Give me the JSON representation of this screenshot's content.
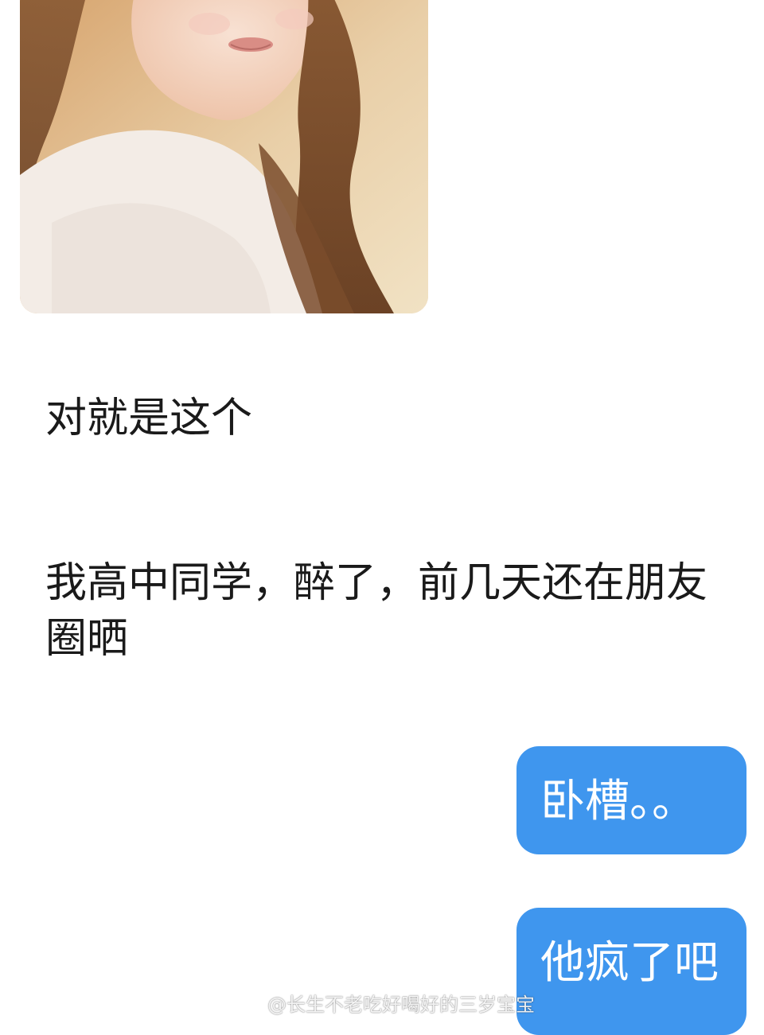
{
  "conversation": {
    "incoming": [
      {
        "text": "对就是这个"
      },
      {
        "text": "我高中同学，醉了，前几天还在朋友圈晒"
      }
    ],
    "outgoing": [
      {
        "text": "卧槽。。"
      },
      {
        "text": "他疯了吧"
      }
    ]
  },
  "watermark": {
    "text": "@长生不老吃好喝好的三岁宝宝",
    "icon": "weibo-icon"
  },
  "colors": {
    "outgoing_bubble": "#3f96ee",
    "background": "#ffffff",
    "incoming_text": "#1a1a1a"
  }
}
